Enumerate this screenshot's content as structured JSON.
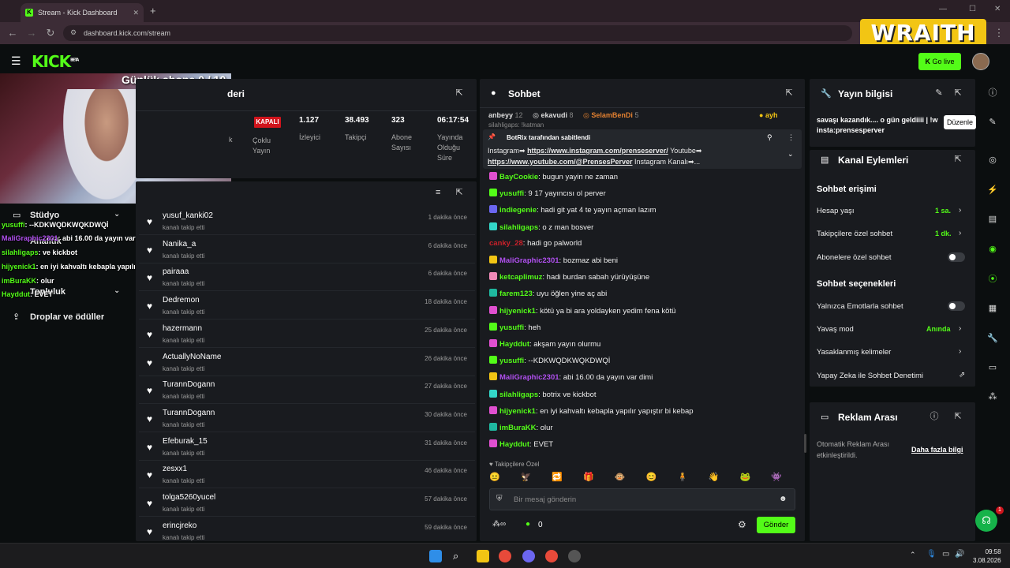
{
  "browser": {
    "tab_title": "Stream - Kick Dashboard",
    "url": "dashboard.kick.com/stream",
    "overlay_brand": "WRAITH"
  },
  "header": {
    "logo": "KICK",
    "logo_sup": "BETA",
    "go_live": "Go live"
  },
  "overlay": {
    "subs_goal": "Günlük abone 0 / 10"
  },
  "sidebar": {
    "items": [
      "Stüdyo",
      "Analitik",
      "Topluluk",
      "Droplar ve ödüller"
    ]
  },
  "overlay_chat": [
    {
      "user": "yusuffi",
      "text": ": --KDKWQDKWQKDWQİ"
    },
    {
      "user": "MaliGraphic2301",
      "text": ": abi 16.00 da yayın var dimi"
    },
    {
      "user": "silahligaps",
      "text": ":  ve kickbot"
    },
    {
      "user": "hijyenick1",
      "text": ": en iyi kahvaltı kebapla yapılır yapıştır bi kebap"
    },
    {
      "user": "imBuraKK",
      "text": ": olur"
    },
    {
      "user": "Hayddut",
      "text": ": EVET"
    }
  ],
  "stats": {
    "panel_title": "deri",
    "status": "KAPALI",
    "multi_label": "Çoklu Yayın",
    "k_label": "k",
    "viewers": {
      "value": "1.127",
      "label": "İzleyici"
    },
    "followers": {
      "value": "38.493",
      "label": "Takipçi"
    },
    "subs": {
      "value": "323",
      "label": "Abone Sayısı"
    },
    "uptime": {
      "value": "06:17:54",
      "label": "Yayında Olduğu Süre"
    }
  },
  "follow_feed": [
    {
      "name": "yusuf_kanki02",
      "action": "kanalı takip etti",
      "time": "1 dakika önce"
    },
    {
      "name": "Nanika_a",
      "action": "kanalı takip etti",
      "time": "6 dakika önce"
    },
    {
      "name": "pairaaa",
      "action": "kanalı takip etti",
      "time": "6 dakika önce"
    },
    {
      "name": "Dedremon",
      "action": "kanalı takip etti",
      "time": "18 dakika önce"
    },
    {
      "name": "hazermann",
      "action": "kanalı takip etti",
      "time": "25 dakika önce"
    },
    {
      "name": "ActuallyNoName",
      "action": "kanalı takip etti",
      "time": "26 dakika önce"
    },
    {
      "name": "TurannDogann",
      "action": "kanalı takip etti",
      "time": "27 dakika önce"
    },
    {
      "name": "TurannDogann",
      "action": "kanalı takip etti",
      "time": "30 dakika önce"
    },
    {
      "name": "Efeburak_15",
      "action": "kanalı takip etti",
      "time": "31 dakika önce"
    },
    {
      "name": "zesxx1",
      "action": "kanalı takip etti",
      "time": "46 dakika önce"
    },
    {
      "name": "tolga5260yucel",
      "action": "kanalı takip etti",
      "time": "57 dakika önce"
    },
    {
      "name": "erincjreko",
      "action": "kanalı takip etti",
      "time": "59 dakika önce"
    }
  ],
  "chat": {
    "title": "Sohbet",
    "leaderboard": [
      {
        "name": "anbeyy",
        "count": "12"
      },
      {
        "name": "ekavudi",
        "count": "8"
      },
      {
        "name": "SelamBenDi",
        "count": "5"
      },
      {
        "name": "ayh",
        "count": ""
      }
    ],
    "partial_line": "silahligaps: !katman",
    "pinned_by": "BotRix tarafından sabitlendi",
    "pinned_line1_a": "Instagram➡ ",
    "pinned_link1": "https://www.instagram.com/prenseserver/",
    "pinned_line1_b": " Youtube➡",
    "pinned_link2": "https://www.youtube.com/@PrensesPerver",
    "pinned_line2_b": " Instagram Kanalı➡...",
    "messages": [
      {
        "user": "BayCookie",
        "text": ": bugun yayin ne zaman",
        "color": "#53fc18",
        "badge": "#e04fd0"
      },
      {
        "user": "yusuffi",
        "text": ": 9 17 yayıncısı ol perver",
        "color": "#53fc18",
        "badge": "#53fc18"
      },
      {
        "user": "indiegenie",
        "text": ": hadi git yat 4 te yayın açman lazım",
        "color": "#53fc18",
        "badge": "#6b66f0"
      },
      {
        "user": "silahligaps",
        "text": ": o z man bosver",
        "color": "#53fc18",
        "badge": "#33d6c8"
      },
      {
        "user": "canky_28",
        "text": ": hadi go palworld",
        "color": "#c8202a",
        "badge": ""
      },
      {
        "user": "MaliGraphic2301",
        "text": ": bozmaz abi beni",
        "color": "#b150f0",
        "badge": "#f2c514"
      },
      {
        "user": "ketcaplimuz",
        "text": ": hadi burdan sabah yürüyüşüne",
        "color": "#53fc18",
        "badge": "#f08ab8"
      },
      {
        "user": "farem123",
        "text": ": uyu öğlen yine aç abi",
        "color": "#53fc18",
        "badge": "#1fb8a0"
      },
      {
        "user": "hijyenick1",
        "text": ": kötü ya bi ara yoldayken yedim fena kötü",
        "color": "#53fc18",
        "badge": "#e04fd0"
      },
      {
        "user": "yusuffi",
        "text": ": heh",
        "color": "#53fc18",
        "badge": "#53fc18"
      },
      {
        "user": "Hayddut",
        "text": ": akşam yayın olurmu",
        "color": "#53fc18",
        "badge": "#e04fd0"
      },
      {
        "user": "yusuffi",
        "text": ": --KDKWQDKWQKDWQİ",
        "color": "#53fc18",
        "badge": "#53fc18"
      },
      {
        "user": "MaliGraphic2301",
        "text": ": abi 16.00 da yayın var dimi",
        "color": "#b150f0",
        "badge": "#f2c514"
      },
      {
        "user": "silahligaps",
        "text": ": botrix ve kickbot",
        "color": "#53fc18",
        "badge": "#33d6c8"
      },
      {
        "user": "hijyenick1",
        "text": ": en iyi kahvaltı kebapla yapılır yapıştır bi kebap",
        "color": "#53fc18",
        "badge": "#e04fd0"
      },
      {
        "user": "imBuraKK",
        "text": ": olur",
        "color": "#53fc18",
        "badge": "#1fb8a0"
      },
      {
        "user": "Hayddut",
        "text": ": EVET",
        "color": "#53fc18",
        "badge": "#e04fd0"
      }
    ],
    "followers_only_label": "Takipçilere Özel",
    "input_placeholder": "Bir mesaj gönderin",
    "points": "0",
    "send": "Gönder"
  },
  "stream_info": {
    "title": "Yayın bilgisi",
    "text1": "savaşı kazandık.... o gün geldiiii | !w",
    "text2": "insta:prensesperver",
    "tooltip": "Düzenle"
  },
  "channel_actions": {
    "title": "Kanal Eylemleri",
    "access_title": "Sohbet erişimi",
    "account_age": {
      "label": "Hesap yaşı",
      "value": "1 sa."
    },
    "followers_only": {
      "label": "Takipçilere özel sohbet",
      "value": "1 dk."
    },
    "subs_only": {
      "label": "Abonelere özel sohbet"
    },
    "options_title": "Sohbet seçenekleri",
    "emotes_only": {
      "label": "Yalnızca Emotlarla sohbet"
    },
    "slow_mode": {
      "label": "Yavaş mod",
      "value": "Anında"
    },
    "banned_words": {
      "label": "Yasaklanmış kelimeler"
    },
    "ai_moderation": {
      "label": "Yapay Zeka ile Sohbet Denetimi"
    }
  },
  "ad_break": {
    "title": "Reklam Arası",
    "desc1": "Otomatik Reklam Arası",
    "desc2": "etkinleştirildi.",
    "more": "Daha fazla bilgi"
  },
  "taskbar": {
    "time": "09:58",
    "date": "3.08.2026"
  },
  "colors": {
    "accent": "#53fc18",
    "panel": "#191b1f",
    "bg": "#0b0e0f",
    "danger": "#d1141c"
  }
}
